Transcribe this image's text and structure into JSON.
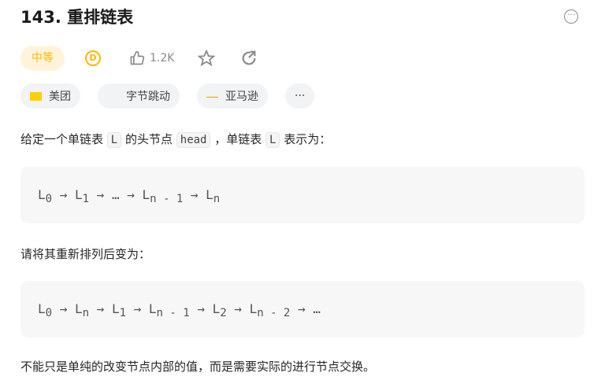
{
  "title": "143. 重排链表",
  "difficulty": "中等",
  "coin_label": "D",
  "likes": "1.2K",
  "more_label": "···",
  "tags": [
    {
      "label": "美团",
      "logo": "美团"
    },
    {
      "label": "字节跳动"
    },
    {
      "label": "亚马逊",
      "logo": "amazon"
    },
    {
      "label": "···"
    }
  ],
  "desc": {
    "p1_a": "给定一个单链表 ",
    "p1_code1": "L",
    "p1_b": " 的头节点 ",
    "p1_code2": "head",
    "p1_c": " ，单链表 ",
    "p1_code3": "L",
    "p1_d": " 表示为：",
    "p2": "请将其重新排列后变为：",
    "p3": "不能只是单纯的改变节点内部的值，而是需要实际的进行节点交换。"
  },
  "block1": [
    {
      "t": "L",
      "s": "0"
    },
    {
      "t": " → L",
      "s": "1"
    },
    {
      "t": " → … → L",
      "s": "n - 1"
    },
    {
      "t": " → L",
      "s": "n"
    }
  ],
  "block2": [
    {
      "t": "L",
      "s": "0"
    },
    {
      "t": " → L",
      "s": "n"
    },
    {
      "t": " → L",
      "s": "1"
    },
    {
      "t": " → L",
      "s": "n - 1"
    },
    {
      "t": " → L",
      "s": "2"
    },
    {
      "t": " → L",
      "s": "n - 2"
    },
    {
      "t": " → …",
      "s": ""
    }
  ]
}
